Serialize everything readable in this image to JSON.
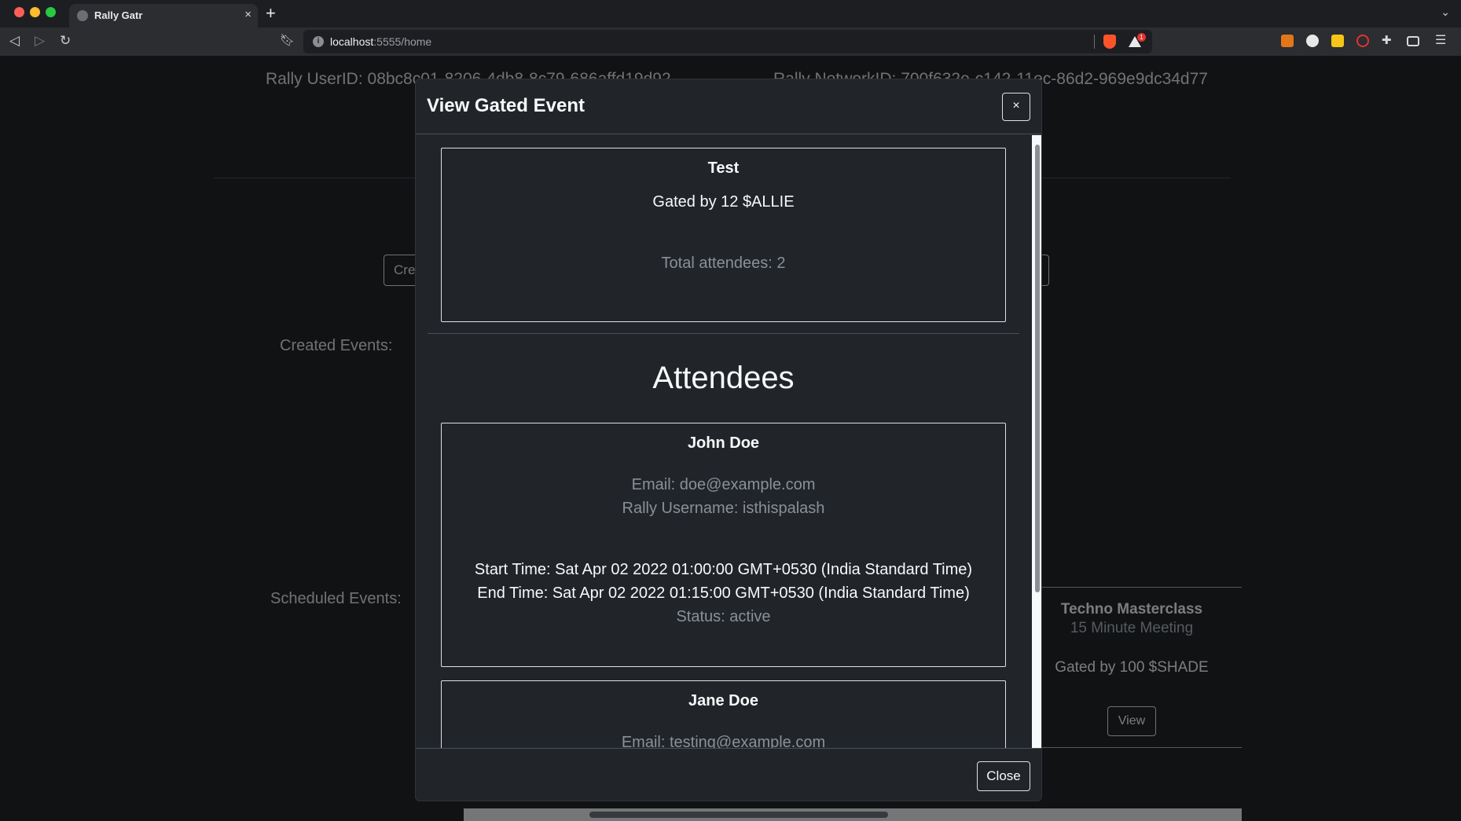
{
  "browser": {
    "tab_title": "Rally Gatr",
    "tab_close": "×",
    "new_tab": "+",
    "tabs_menu": "⌄",
    "url_host": "localhost",
    "url_rest": ":5555/home",
    "rewards_badge": "1",
    "menu": "☰"
  },
  "page": {
    "user_id": "Rally UserID: 08bc8c01-8206-4db8-8c79-686affd19d92",
    "network_id": "Rally NetworkID: 700f632e-c142-11ec-86d2-969e9dc34d77",
    "create_button": "Create",
    "created_events_label": "Created Events:",
    "scheduled_events_label": "Scheduled Events:",
    "scheduled_card": {
      "title": "Techno Masterclass",
      "subtitle": "15 Minute Meeting",
      "gated": "Gated by 100 $SHADE",
      "view_button": "View"
    }
  },
  "modal": {
    "title": "View Gated Event",
    "close_x": "×",
    "event": {
      "name": "Test",
      "gated": "Gated by 12 $ALLIE",
      "total_attendees": "Total attendees: 2"
    },
    "attendees_heading": "Attendees",
    "attendees": [
      {
        "name": "John Doe",
        "email": "Email: doe@example.com",
        "username": "Rally Username: isthispalash",
        "start_time": "Start Time: Sat Apr 02 2022 01:00:00 GMT+0530 (India Standard Time)",
        "end_time": "End Time: Sat Apr 02 2022 01:15:00 GMT+0530 (India Standard Time)",
        "status": "Status: active"
      },
      {
        "name": "Jane Doe",
        "email": "Email: testing@example.com"
      }
    ],
    "close_button": "Close"
  }
}
